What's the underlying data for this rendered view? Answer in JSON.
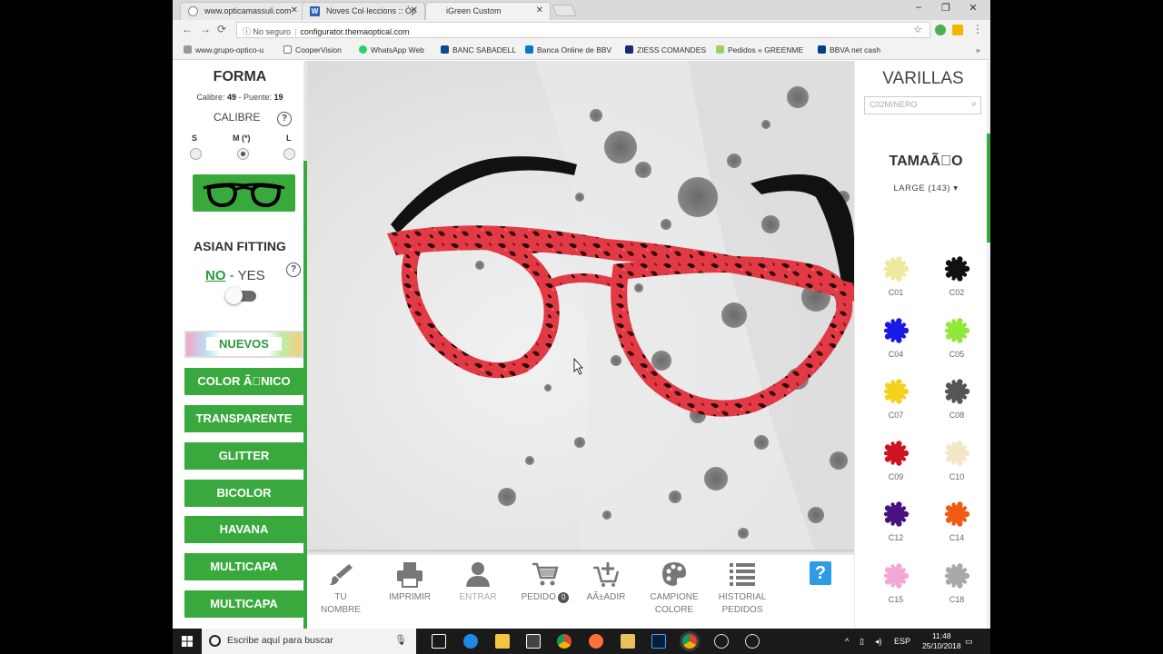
{
  "browser": {
    "tabs": [
      {
        "title": "www.opticamassuli.com"
      },
      {
        "title": "Noves Col·leccions :: Óp"
      },
      {
        "title": "iGreen Custom"
      }
    ],
    "security": "No seguro",
    "url": "configurator.themaoptical.com",
    "bookmarks": [
      "www.grupo-optico-u",
      "CooperVision",
      "WhatsApp Web",
      "BANC SABADELL",
      "Banca Online de BBV",
      "ZIESS COMANDES",
      "Pedidos « GREENME",
      "BBVA net cash"
    ],
    "bookmarks_more": "»",
    "window_controls": {
      "minimize": "–",
      "maximize": "❐",
      "close": "✕"
    }
  },
  "left": {
    "forma_title": "FORMA",
    "calibre_label": "Calibre:",
    "calibre_value": "49",
    "puente_label": "Puente:",
    "puente_value": "19",
    "calibre_heading": "CALIBRE",
    "sizes": [
      "S",
      "M (*)",
      "L"
    ],
    "asian_title": "ASIAN FITTING",
    "no_label": "NO",
    "yes_label": "- YES",
    "help": "?",
    "nuevos": "NUEVOS",
    "categories": [
      "COLOR Ã\u0000NICO",
      "TRANSPARENTE",
      "GLITTER",
      "BICOLOR",
      "HAVANA",
      "MULTICAPA",
      "MULTICAPA"
    ]
  },
  "toolbar": {
    "tools": [
      {
        "label1": "TU",
        "label2": "NOMBRE"
      },
      {
        "label1": "IMPRIMIR",
        "label2": ""
      },
      {
        "label1": "ENTRAR",
        "label2": ""
      },
      {
        "label1": "PEDIDO",
        "label2": ""
      },
      {
        "label1": "AÃ±ADIR",
        "label2": ""
      },
      {
        "label1": "CAMPIONE",
        "label2": "COLORE"
      },
      {
        "label1": "HISTORIAL",
        "label2": "PEDIDOS"
      }
    ],
    "pedido_count": "0",
    "help": "?"
  },
  "right": {
    "title": "VARILLAS",
    "search_value": "C02M/NERO",
    "size_title": "TAMAÃ\u0000O",
    "size_value": "LARGE (143)",
    "swatches": [
      {
        "code": "C01",
        "color": "#ecea9c"
      },
      {
        "code": "C02",
        "color": "#111111"
      },
      {
        "code": "C04",
        "color": "#1a1ae6"
      },
      {
        "code": "C05",
        "color": "#8fe83a"
      },
      {
        "code": "C07",
        "color": "#f2d21c"
      },
      {
        "code": "C08",
        "color": "#555555"
      },
      {
        "code": "C09",
        "color": "#cc1320"
      },
      {
        "code": "C10",
        "color": "#f5e6c8"
      },
      {
        "code": "C12",
        "color": "#4a1180"
      },
      {
        "code": "C14",
        "color": "#ef5a14"
      },
      {
        "code": "C15",
        "color": "#f2a8d6"
      },
      {
        "code": "C18",
        "color": "#a9a9a9"
      }
    ]
  },
  "taskbar": {
    "search_placeholder": "Escribe aquí para buscar",
    "lang": "ESP",
    "time": "11:48",
    "date": "25/10/2018"
  },
  "colors": {
    "accent": "#3aa93d",
    "frame_red": "#e0283a",
    "temple_black": "#111111"
  }
}
